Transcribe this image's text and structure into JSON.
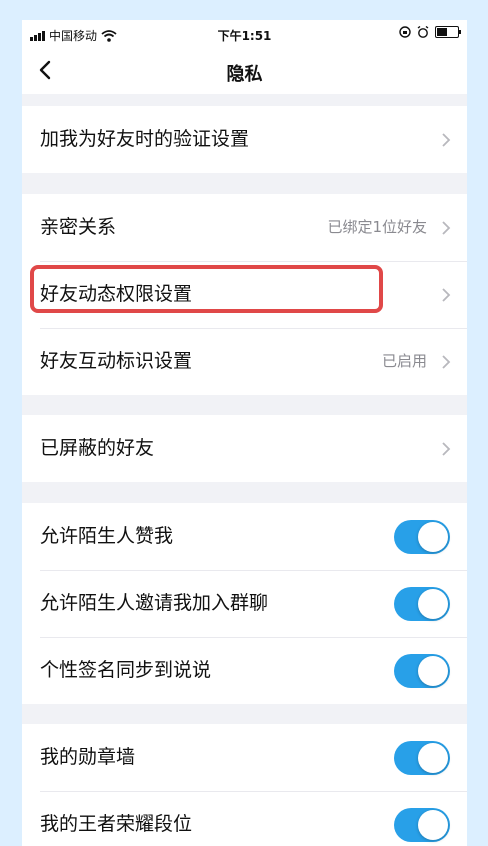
{
  "status_bar": {
    "carrier": "中国移动",
    "time": "下午1:51"
  },
  "nav": {
    "title": "隐私"
  },
  "groups": [
    {
      "rows": [
        {
          "label": "加我为好友时的验证设置",
          "value": "",
          "control": "chevron"
        }
      ]
    },
    {
      "rows": [
        {
          "label": "亲密关系",
          "value": "已绑定1位好友",
          "control": "chevron"
        },
        {
          "label": "好友动态权限设置",
          "value": "",
          "control": "chevron",
          "highlighted": true
        },
        {
          "label": "好友互动标识设置",
          "value": "已启用",
          "control": "chevron"
        }
      ]
    },
    {
      "rows": [
        {
          "label": "已屏蔽的好友",
          "value": "",
          "control": "chevron"
        }
      ]
    },
    {
      "rows": [
        {
          "label": "允许陌生人赞我",
          "control": "toggle",
          "on": true
        },
        {
          "label": "允许陌生人邀请我加入群聊",
          "control": "toggle",
          "on": true
        },
        {
          "label": "个性签名同步到说说",
          "control": "toggle",
          "on": true
        }
      ]
    },
    {
      "rows": [
        {
          "label": "我的勋章墙",
          "control": "toggle",
          "on": true
        },
        {
          "label": "我的王者荣耀段位",
          "control": "toggle",
          "on": true
        }
      ]
    }
  ],
  "colors": {
    "toggle_on": "#28a0e8",
    "highlight_border": "#e04848",
    "background": "#f1f2f6"
  },
  "icons": [
    "signal-icon",
    "wifi-icon",
    "lock-rotation-icon",
    "alarm-icon",
    "battery-icon",
    "back-chevron-icon",
    "chevron-right-icon"
  ]
}
